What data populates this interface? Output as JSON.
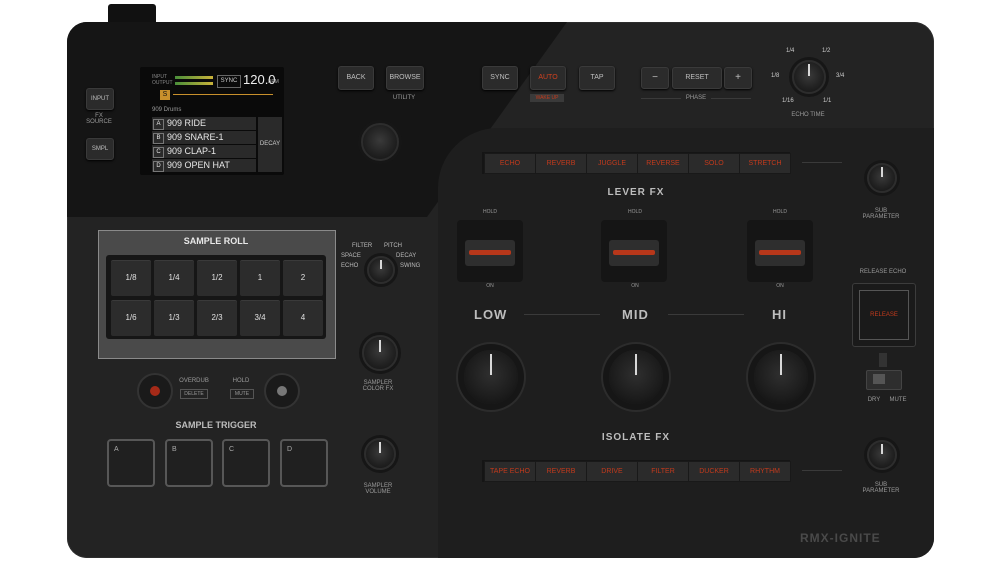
{
  "screen": {
    "input_output": "INPUT\nOUTPUT",
    "sync_label": "SYNC",
    "bpm_value": "120.0",
    "bpm_unit": "BPM",
    "bank_badge": "S",
    "folder": "909 Drums",
    "samples": [
      {
        "tag": "A",
        "name": "909 RIDE"
      },
      {
        "tag": "B",
        "name": "909 SNARE-1"
      },
      {
        "tag": "C",
        "name": "909 CLAP-1"
      },
      {
        "tag": "D",
        "name": "909 OPEN HAT"
      }
    ],
    "decay_label": "DECAY"
  },
  "fx_source": {
    "label": "FX\nSOURCE",
    "input": "INPUT",
    "smpl": "SMPL"
  },
  "top_buttons": {
    "back": "BACK",
    "browse": "BROWSE",
    "utility": "UTILITY",
    "sync": "SYNC",
    "auto": "AUTO",
    "wake_up": "WAKE UP",
    "tap": "TAP",
    "minus": "−",
    "reset": "RESET",
    "plus": "+",
    "phase": "PHASE"
  },
  "echo_time": {
    "label": "ECHO TIME",
    "values": [
      "1/4",
      "1/2",
      "1/8",
      "3/4",
      "1/16",
      "1/1"
    ]
  },
  "lever_fx": {
    "title": "LEVER FX",
    "buttons": [
      "ECHO",
      "REVERB",
      "JUGGLE",
      "REVERSE",
      "SOLO",
      "STRETCH"
    ],
    "hold": "HOLD",
    "on": "ON"
  },
  "sub_parameter": "SUB\nPARAMETER",
  "sample_roll": {
    "title": "SAMPLE ROLL",
    "pads": [
      "1/8",
      "1/4",
      "1/2",
      "1",
      "2",
      "1/6",
      "1/3",
      "2/3",
      "3/4",
      "4"
    ]
  },
  "color_fx_selector": {
    "filter": "FILTER",
    "pitch": "PITCH",
    "space": "SPACE",
    "decay": "DECAY",
    "echo": "ECHO",
    "swing": "SWING"
  },
  "sampler": {
    "color_fx": "SAMPLER\nCOLOR FX",
    "volume": "SAMPLER\nVOLUME",
    "overdub": "OVERDUB",
    "delete": "DELETE",
    "hold": "HOLD",
    "mute": "MUTE",
    "trigger_title": "SAMPLE TRIGGER",
    "triggers": [
      "A",
      "B",
      "C",
      "D"
    ]
  },
  "eq": {
    "low": "LOW",
    "mid": "MID",
    "hi": "HI"
  },
  "isolate_fx": {
    "title": "ISOLATE FX",
    "buttons": [
      "TAPE ECHO",
      "REVERB",
      "DRIVE",
      "FILTER",
      "DUCKER",
      "RHYTHM"
    ]
  },
  "release_echo": {
    "title": "RELEASE ECHO",
    "button": "RELEASE",
    "dry": "DRY",
    "mute": "MUTE"
  },
  "model": "RMX-IGNITE",
  "colors": {
    "accent": "#c23a1c",
    "body": "#232323",
    "screen": "#0a0a0a"
  }
}
